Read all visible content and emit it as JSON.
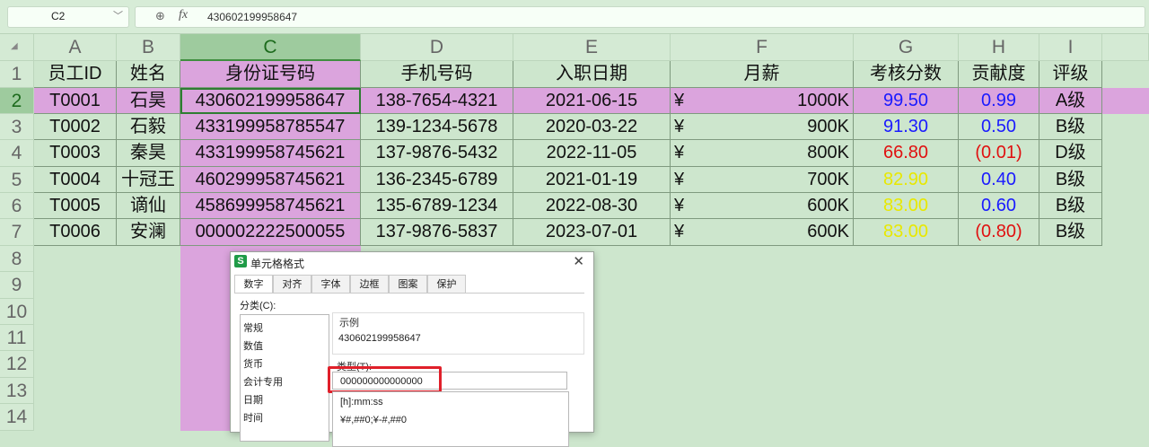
{
  "formula_bar": {
    "name_box": "C2",
    "value": "430602199958647"
  },
  "columns": [
    "A",
    "B",
    "C",
    "D",
    "E",
    "F",
    "G",
    "H",
    "I"
  ],
  "rows": [
    "1",
    "2",
    "3",
    "4",
    "5",
    "6",
    "7",
    "8",
    "9",
    "10",
    "11",
    "12",
    "13",
    "14"
  ],
  "headers": [
    "员工ID",
    "姓名",
    "身份证号码",
    "手机号码",
    "入职日期",
    "月薪",
    "考核分数",
    "贡献度",
    "评级"
  ],
  "records": [
    {
      "id": "T0001",
      "name": "石昊",
      "idno": "430602199958647",
      "phone": "138-7654-4321",
      "date": "2021-06-15",
      "cur": "¥",
      "salary": "1000K",
      "score": "99.50",
      "contrib": "0.99",
      "grade": "A级",
      "score_color": "#1a1aff",
      "contrib_color": "#1a1aff"
    },
    {
      "id": "T0002",
      "name": "石毅",
      "idno": "433199958785547",
      "phone": "139-1234-5678",
      "date": "2020-03-22",
      "cur": "¥",
      "salary": "900K",
      "score": "91.30",
      "contrib": "0.50",
      "grade": "B级",
      "score_color": "#1a1aff",
      "contrib_color": "#1a1aff"
    },
    {
      "id": "T0003",
      "name": "秦昊",
      "idno": "433199958745621",
      "phone": "137-9876-5432",
      "date": "2022-11-05",
      "cur": "¥",
      "salary": "800K",
      "score": "66.80",
      "contrib": "(0.01)",
      "grade": "D级",
      "score_color": "#e01010",
      "contrib_color": "#e01010"
    },
    {
      "id": "T0004",
      "name": "十冠王",
      "idno": "460299958745621",
      "phone": "136-2345-6789",
      "date": "2021-01-19",
      "cur": "¥",
      "salary": "700K",
      "score": "82.90",
      "contrib": "0.40",
      "grade": "B级",
      "score_color": "#e8e800",
      "contrib_color": "#1a1aff"
    },
    {
      "id": "T0005",
      "name": "谪仙",
      "idno": "458699958745621",
      "phone": "135-6789-1234",
      "date": "2022-08-30",
      "cur": "¥",
      "salary": "600K",
      "score": "83.00",
      "contrib": "0.60",
      "grade": "B级",
      "score_color": "#e8e800",
      "contrib_color": "#1a1aff"
    },
    {
      "id": "T0006",
      "name": "安澜",
      "idno": "000002222500055",
      "phone": "137-9876-5837",
      "date": "2023-07-01",
      "cur": "¥",
      "salary": "600K",
      "score": "83.00",
      "contrib": "(0.80)",
      "grade": "B级",
      "score_color": "#e8e800",
      "contrib_color": "#e01010"
    }
  ],
  "dialog": {
    "title": "单元格格式",
    "app_logo": "S",
    "tabs": [
      "数字",
      "对齐",
      "字体",
      "边框",
      "图案",
      "保护"
    ],
    "category_label": "分类(C):",
    "categories": [
      "常规",
      "数值",
      "货币",
      "会计专用",
      "日期",
      "时间"
    ],
    "sample_label": "示例",
    "sample_value": "430602199958647",
    "type_label": "类型(T):",
    "type_value": "000000000000000",
    "type_list": [
      "[h]:mm:ss",
      "¥#,##0;¥-#,##0"
    ]
  }
}
